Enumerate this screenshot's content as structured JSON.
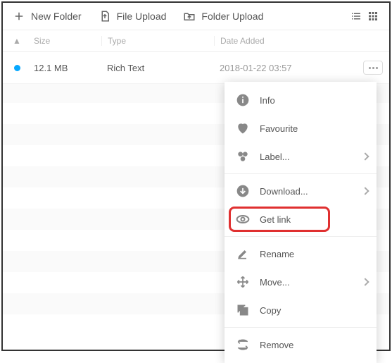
{
  "toolbar": {
    "new_folder": "New Folder",
    "file_upload": "File Upload",
    "folder_upload": "Folder Upload"
  },
  "headers": {
    "size": "Size",
    "type": "Type",
    "date": "Date Added"
  },
  "row": {
    "size": "12.1 MB",
    "type": "Rich Text",
    "date": "2018-01-22 03:57"
  },
  "menu": {
    "info": "Info",
    "favourite": "Favourite",
    "label": "Label...",
    "download": "Download...",
    "get_link": "Get link",
    "rename": "Rename",
    "move": "Move...",
    "copy": "Copy",
    "remove": "Remove"
  }
}
